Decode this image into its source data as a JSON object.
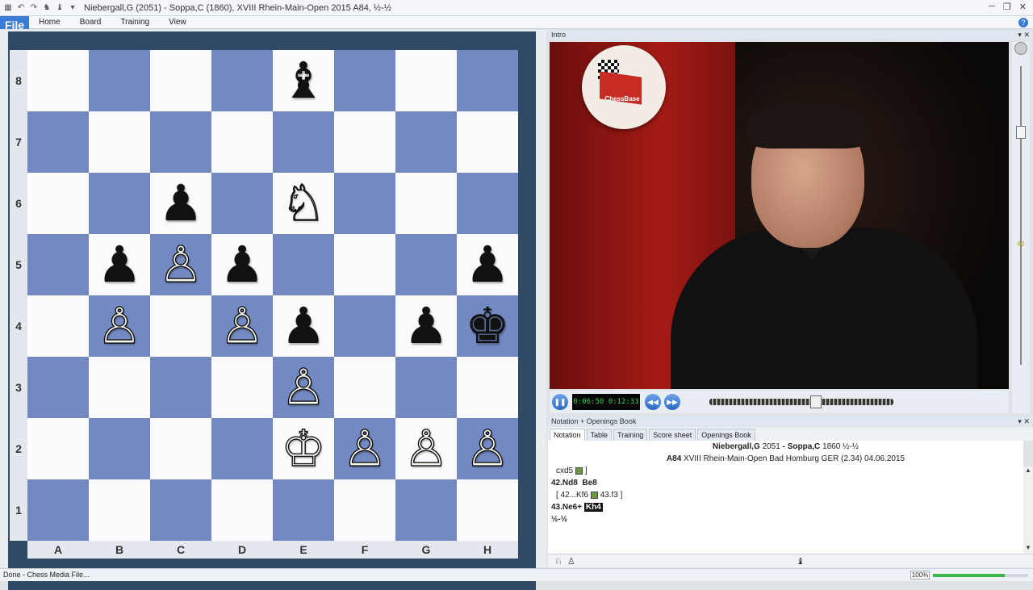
{
  "titlebar": {
    "title": "Niebergall,G (2051) - Soppa,C (1860), XVIII Rhein-Main-Open 2015  A84, ½-½"
  },
  "ribbon": {
    "tabs": [
      "File",
      "Home",
      "Board",
      "Training",
      "View"
    ],
    "help_label": "?"
  },
  "board": {
    "ranks": [
      "8",
      "7",
      "6",
      "5",
      "4",
      "3",
      "2",
      "1"
    ],
    "files": [
      "A",
      "B",
      "C",
      "D",
      "E",
      "F",
      "G",
      "H"
    ],
    "pieces": [
      {
        "square": "e8",
        "glyph": "♝",
        "color": "black",
        "name": "bishop"
      },
      {
        "square": "c6",
        "glyph": "♟",
        "color": "black",
        "name": "pawn"
      },
      {
        "square": "e6",
        "glyph": "♘",
        "color": "white",
        "name": "knight"
      },
      {
        "square": "b5",
        "glyph": "♟",
        "color": "black",
        "name": "pawn"
      },
      {
        "square": "c5",
        "glyph": "♙",
        "color": "white",
        "name": "pawn"
      },
      {
        "square": "d5",
        "glyph": "♟",
        "color": "black",
        "name": "pawn"
      },
      {
        "square": "h5",
        "glyph": "♟",
        "color": "black",
        "name": "pawn"
      },
      {
        "square": "b4",
        "glyph": "♙",
        "color": "white",
        "name": "pawn"
      },
      {
        "square": "d4",
        "glyph": "♙",
        "color": "white",
        "name": "pawn"
      },
      {
        "square": "e4",
        "glyph": "♟",
        "color": "black",
        "name": "pawn"
      },
      {
        "square": "g4",
        "glyph": "♟",
        "color": "black",
        "name": "pawn"
      },
      {
        "square": "h4",
        "glyph": "♚",
        "color": "black",
        "name": "king"
      },
      {
        "square": "e3",
        "glyph": "♙",
        "color": "white",
        "name": "pawn"
      },
      {
        "square": "e2",
        "glyph": "♔",
        "color": "white",
        "name": "king"
      },
      {
        "square": "f2",
        "glyph": "♙",
        "color": "white",
        "name": "pawn"
      },
      {
        "square": "g2",
        "glyph": "♙",
        "color": "white",
        "name": "pawn"
      },
      {
        "square": "h2",
        "glyph": "♙",
        "color": "white",
        "name": "pawn"
      }
    ],
    "colors": {
      "light": "#fbfbfd",
      "dark": "#7389c2",
      "frame": "#2f4a67"
    }
  },
  "video": {
    "panel_title": "Intro",
    "logo_text": "ChessBase",
    "time_display": "0:06:50 0:12:33",
    "level_value": "62",
    "progress": 0.58
  },
  "notation": {
    "panel_title": "Notation + Openings Book",
    "tabs": [
      "Notation",
      "Table",
      "Training",
      "Score sheet",
      "Openings Book"
    ],
    "white_player": "Niebergall,G",
    "white_elo": "2051",
    "separator": "-",
    "black_player": "Soppa,C",
    "black_elo": "1860",
    "result": "½-½",
    "eco": "A84",
    "event": "XVIII Rhein-Main-Open Bad Homburg GER (2.34) 04.06.2015",
    "moves": {
      "line1_move": "cxd5",
      "line1_close": "]",
      "line2_move": "42.Nd8",
      "line2_reply": "Be8",
      "line3_open": "[ 42...Kf6",
      "line3_move": "43.f3 ]",
      "line4_move": "43.Ne6+",
      "line4_current": "Kh4",
      "line5_result": "½-½"
    }
  },
  "status": {
    "text": "Done - Chess Media File...",
    "zoom": "100%",
    "zoom_level": 0.75
  }
}
